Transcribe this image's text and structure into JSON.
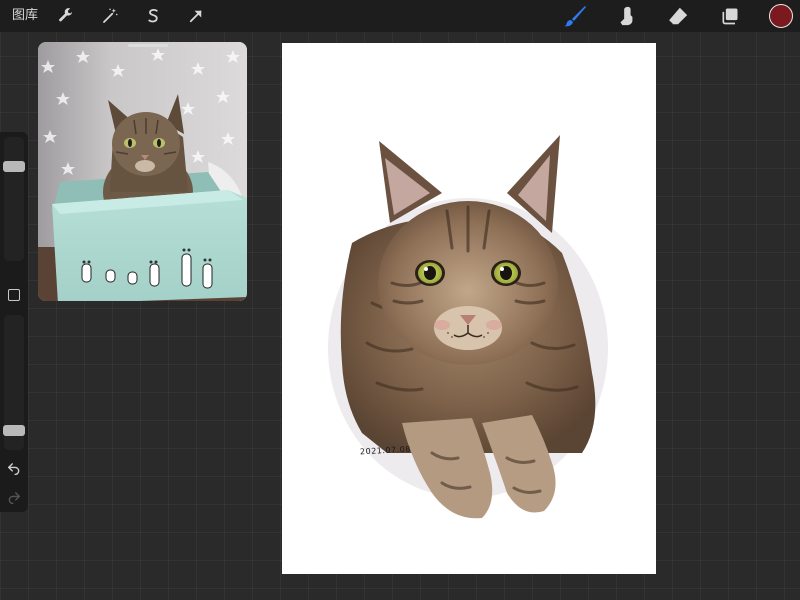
{
  "topbar": {
    "gallery_label": "图库",
    "tools_left": [
      {
        "name": "actions-wrench-icon"
      },
      {
        "name": "adjustments-wand-icon"
      },
      {
        "name": "selection-s-icon"
      },
      {
        "name": "transform-arrow-icon"
      }
    ],
    "tools_right": [
      {
        "name": "brush-icon",
        "active": true
      },
      {
        "name": "smudge-icon"
      },
      {
        "name": "eraser-icon"
      },
      {
        "name": "layers-icon"
      }
    ],
    "current_color": "#7a1a1e"
  },
  "sidebar": {
    "brush_size_level": 0.8,
    "opacity_level": 0.1,
    "icons": [
      "modify-square-icon",
      "undo-icon",
      "redo-icon"
    ]
  },
  "reference": {
    "kind": "photo",
    "subject": "cat"
  },
  "canvas": {
    "background": "#ffffff",
    "subject": "cat",
    "signature": "2021.07.08"
  },
  "colors": {
    "app_bg": "#2a2a2a",
    "toolbar_bg": "#1d1d1d",
    "accent_blue": "#2f7bf0"
  }
}
